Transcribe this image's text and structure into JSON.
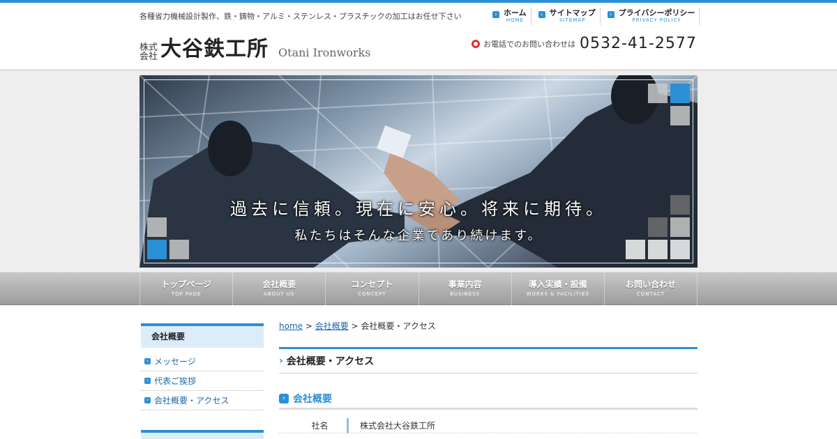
{
  "header": {
    "tagline": "各種省力機械設計製作、鉄・鋳物・アルミ・ステンレス・プラスチックの加工はお任せ下さい",
    "logo_kabushiki": "株式",
    "logo_kaisha": "会社",
    "logo_name": "大谷鉄工所",
    "logo_en": "Otani Ironworks",
    "phone_label": "お電話でのお問い合わせは",
    "phone_number": "0532-41-2577"
  },
  "util_nav": [
    {
      "ja": "ホーム",
      "en": "HOME"
    },
    {
      "ja": "サイトマップ",
      "en": "SITEMAP"
    },
    {
      "ja": "プライバシーポリシー",
      "en": "PRIVACY POLICY"
    }
  ],
  "hero": {
    "line1": "過去に信頼。現在に安心。将来に期待。",
    "line2": "私たちはそんな企業であり続けます。"
  },
  "global_nav": [
    {
      "ja": "トップページ",
      "en": "TOP PAGE"
    },
    {
      "ja": "会社概要",
      "en": "ABOUT US"
    },
    {
      "ja": "コンセプト",
      "en": "CONCEPT"
    },
    {
      "ja": "事業内容",
      "en": "BUSINESS"
    },
    {
      "ja": "導入実績・設備",
      "en": "WORKS & FACILITIES"
    },
    {
      "ja": "お問い合わせ",
      "en": "CONTACT"
    }
  ],
  "sidebar": {
    "heading": "会社概要",
    "items": [
      {
        "label": "メッセージ"
      },
      {
        "label": "代表ご挨拶"
      },
      {
        "label": "会社概要・アクセス"
      }
    ]
  },
  "breadcrumb": {
    "home": "home",
    "sep1": " > ",
    "about": "会社概要",
    "sep2": " > ",
    "current": "会社概要・アクセス"
  },
  "main": {
    "page_title": "会社概要・アクセス",
    "section_title": "会社概要",
    "info": [
      {
        "key": "社名",
        "value": "株式会社大谷鉄工所"
      }
    ]
  },
  "colors": {
    "accent": "#2b8fd6",
    "phone_ring": "#dd3333"
  }
}
